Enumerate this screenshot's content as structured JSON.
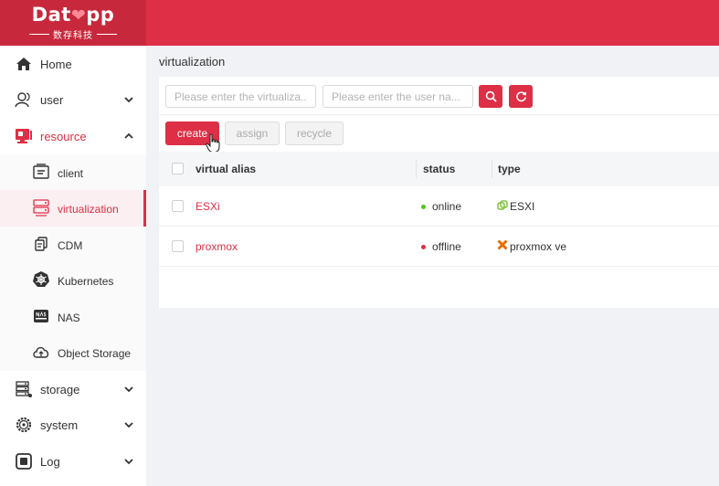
{
  "brand": {
    "name_pre": "Dat",
    "name_mark": "❤",
    "name_post": "pp",
    "tagline": "数存科技"
  },
  "sidebar": {
    "items": [
      {
        "label": "Home",
        "icon": "home-icon"
      },
      {
        "label": "user",
        "icon": "user-icon"
      },
      {
        "label": "resource",
        "icon": "monitor-icon"
      },
      {
        "label": "storage",
        "icon": "server-icon"
      },
      {
        "label": "system",
        "icon": "settings-gear-icon"
      },
      {
        "label": "Log",
        "icon": "log-icon"
      }
    ],
    "resource_children": [
      {
        "label": "client",
        "icon": "client-icon"
      },
      {
        "label": "virtualization",
        "icon": "virtualization-icon"
      },
      {
        "label": "CDM",
        "icon": "cdm-icon"
      },
      {
        "label": "Kubernetes",
        "icon": "kubernetes-icon"
      },
      {
        "label": "NAS",
        "icon": "nas-icon"
      },
      {
        "label": "Object Storage",
        "icon": "cloud-icon"
      }
    ],
    "active": "virtualization"
  },
  "page": {
    "title": "virtualization"
  },
  "filters": {
    "alias_placeholder": "Please enter the virtualiza...",
    "user_placeholder": "Please enter the user na..."
  },
  "toolbar": {
    "create": "create",
    "assign": "assign",
    "recycle": "recycle"
  },
  "table": {
    "columns": {
      "alias": "virtual alias",
      "status": "status",
      "type": "type"
    },
    "rows": [
      {
        "alias": "ESXi",
        "status": "online",
        "status_color": "#52c41a",
        "type": "ESXI",
        "type_icon": "esxi-icon",
        "type_color": "#7cc242"
      },
      {
        "alias": "proxmox",
        "status": "offline",
        "status_color": "#dd2f45",
        "type": "proxmox ve",
        "type_icon": "proxmox-icon",
        "type_color": "#e57000"
      }
    ]
  },
  "colors": {
    "accent": "#dd2f45",
    "sidebar_bg": "#ffffff",
    "page_bg": "#f0f2f5"
  }
}
